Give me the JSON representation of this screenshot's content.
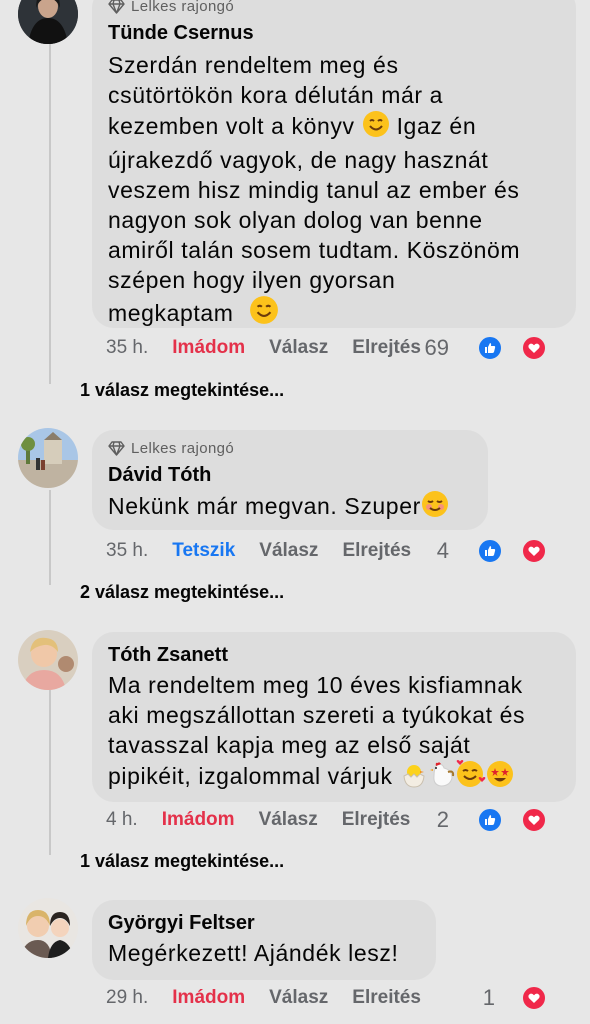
{
  "comments": [
    {
      "badge": "Lelkes rajongó",
      "author": "Tünde Csernus",
      "text": "Szerdán rendeltem meg és\ncsütörtökön kora délután már a\nkezemben volt a könyv",
      "text_b": "Igaz én\nújrakezdő vagyok, de nagy hasznát\nveszem hisz mindig tanul az ember és\nnagyon sok olyan dolog van benne\namiről talán sosem tudtam. Köszönöm\nszépen  hogy ilyen gyorsan\nmegkaptam",
      "time": "35 h.",
      "reaction_label": "Imádom",
      "reply_label": "Válasz",
      "hide_label": "Elrejtés",
      "reaction_count": "69",
      "view_replies": "1 válasz megtekintése..."
    },
    {
      "badge": "Lelkes rajongó",
      "author": "Dávid Tóth",
      "text": "Nekünk már megvan. Szuper",
      "time": "35 h.",
      "reaction_label": "Tetszik",
      "reply_label": "Válasz",
      "hide_label": "Elrejtés",
      "reaction_count": "4",
      "view_replies": "2 válasz megtekintése..."
    },
    {
      "author": "Tóth Zsanett",
      "text": "Ma rendeltem meg 10 éves kisfiamnak\naki megszállottan szereti a tyúkokat és\ntavasszal kapja meg az első saját\npipikéit, izgalommal várjuk",
      "time": "4 h.",
      "reaction_label": "Imádom",
      "reply_label": "Válasz",
      "hide_label": "Elrejtés",
      "reaction_count": "2",
      "view_replies": "1 válasz megtekintése..."
    },
    {
      "author": "Györgyi Feltser",
      "text": "Megérkezett! Ajándék lesz!",
      "time": "29 h.",
      "reaction_label": "Imádom",
      "reply_label": "Válasz",
      "hide_label": "Elreités",
      "reaction_count": "1"
    }
  ],
  "colors": {
    "love": "#e4314a",
    "like": "#1877f2",
    "bubble": "#dddddd",
    "background": "#e7e7e7"
  }
}
